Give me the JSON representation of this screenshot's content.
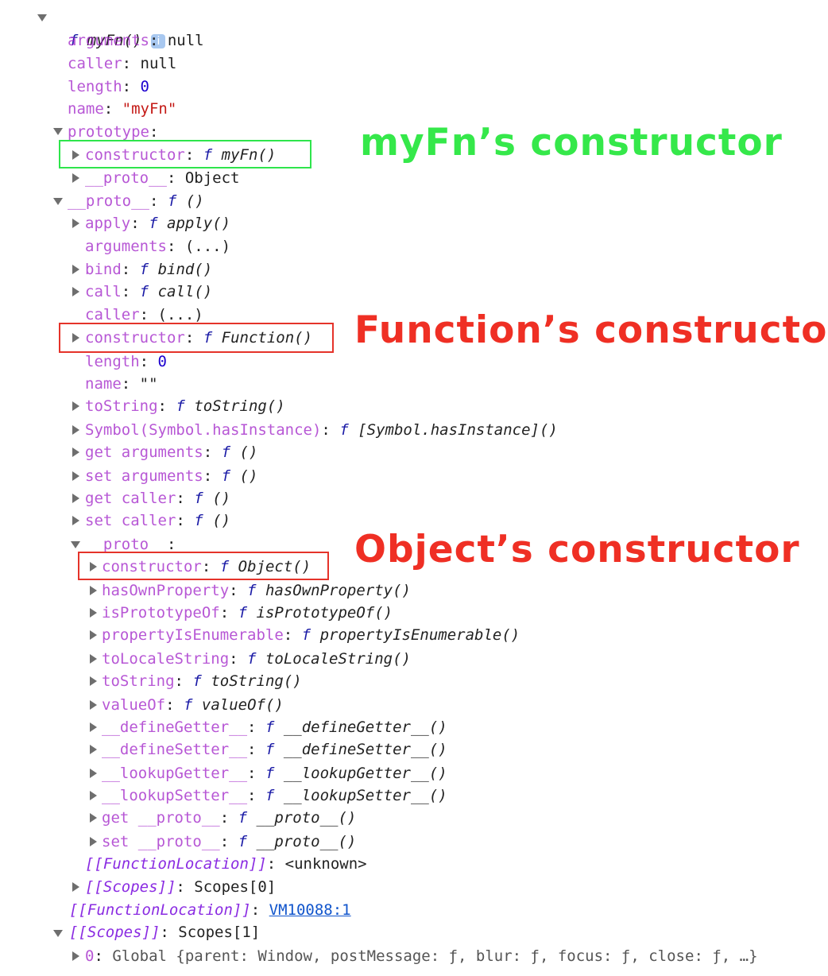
{
  "root": {
    "f": "f",
    "label": "myFn()",
    "info": "i"
  },
  "rows": {
    "arguments": {
      "key": "arguments",
      "value": "null"
    },
    "caller": {
      "key": "caller",
      "value": "null"
    },
    "length": {
      "key": "length",
      "value": "0"
    },
    "name": {
      "key": "name",
      "value": "\"myFn\""
    },
    "prototype": {
      "key": "prototype"
    },
    "proto_constructor": {
      "key": "constructor",
      "f": "f",
      "value": "myFn()"
    },
    "proto_proto": {
      "key": "__proto__",
      "value": "Object"
    },
    "fproto": {
      "key": "__proto__",
      "f": "f",
      "value": "()"
    },
    "apply": {
      "key": "apply",
      "f": "f",
      "value": "apply()"
    },
    "arguments2": {
      "key": "arguments",
      "value": "(...)"
    },
    "bind": {
      "key": "bind",
      "f": "f",
      "value": "bind()"
    },
    "call": {
      "key": "call",
      "f": "f",
      "value": "call()"
    },
    "caller2": {
      "key": "caller",
      "value": "(...)"
    },
    "f_constructor": {
      "key": "constructor",
      "f": "f",
      "value": "Function()"
    },
    "length2": {
      "key": "length",
      "value": "0"
    },
    "name2": {
      "key": "name",
      "value": "\"\""
    },
    "toString": {
      "key": "toString",
      "f": "f",
      "value": "toString()"
    },
    "hasInstance": {
      "key": "Symbol(Symbol.hasInstance)",
      "f": "f",
      "value": "[Symbol.hasInstance]()"
    },
    "get_arguments": {
      "key": "get arguments",
      "f": "f",
      "value": "()"
    },
    "set_arguments": {
      "key": "set arguments",
      "f": "f",
      "value": "()"
    },
    "get_caller": {
      "key": "get caller",
      "f": "f",
      "value": "()"
    },
    "set_caller": {
      "key": "set caller",
      "f": "f",
      "value": "()"
    },
    "oproto": {
      "key": "__proto__"
    },
    "o_constructor": {
      "key": "constructor",
      "f": "f",
      "value": "Object()"
    },
    "hasOwnProperty": {
      "key": "hasOwnProperty",
      "f": "f",
      "value": "hasOwnProperty()"
    },
    "isPrototypeOf": {
      "key": "isPrototypeOf",
      "f": "f",
      "value": "isPrototypeOf()"
    },
    "propertyIsEnumerable": {
      "key": "propertyIsEnumerable",
      "f": "f",
      "value": "propertyIsEnumerable()"
    },
    "toLocaleString": {
      "key": "toLocaleString",
      "f": "f",
      "value": "toLocaleString()"
    },
    "toString2": {
      "key": "toString",
      "f": "f",
      "value": "toString()"
    },
    "valueOf": {
      "key": "valueOf",
      "f": "f",
      "value": "valueOf()"
    },
    "defineGetter": {
      "key": "__defineGetter__",
      "f": "f",
      "value": "__defineGetter__()"
    },
    "defineSetter": {
      "key": "__defineSetter__",
      "f": "f",
      "value": "__defineSetter__()"
    },
    "lookupGetter": {
      "key": "__lookupGetter__",
      "f": "f",
      "value": "__lookupGetter__()"
    },
    "lookupSetter": {
      "key": "__lookupSetter__",
      "f": "f",
      "value": "__lookupSetter__()"
    },
    "get_proto": {
      "key": "get __proto__",
      "f": "f",
      "value": "__proto__()"
    },
    "set_proto": {
      "key": "set __proto__",
      "f": "f",
      "value": "__proto__()"
    },
    "fnloc_inner": {
      "key": "[[FunctionLocation]]",
      "value": "<unknown>"
    },
    "scopes_inner": {
      "key": "[[Scopes]]",
      "value": "Scopes[0]"
    },
    "fnloc": {
      "key": "[[FunctionLocation]]",
      "value": "VM10088:1"
    },
    "scopes": {
      "key": "[[Scopes]]",
      "value": "Scopes[1]"
    },
    "global": {
      "key": "0",
      "value": "Global {parent: Window, postMessage: ƒ, blur: ƒ, focus: ƒ, close: ƒ, …}"
    }
  },
  "annotations": {
    "myfn": "myFn’s constructor",
    "function": "Function’s constructor",
    "object": "Object’s constructor"
  },
  "colors": {
    "green": "#35e84a",
    "red": "#ef2f24"
  }
}
